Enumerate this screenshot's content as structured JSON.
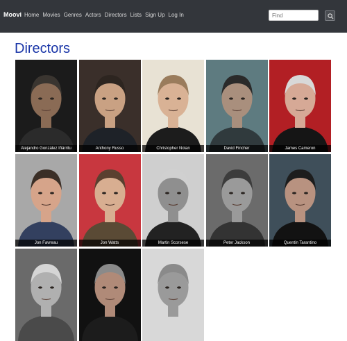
{
  "nav": {
    "brand": "Moovi",
    "links": [
      "Home",
      "Movies",
      "Genres",
      "Actors",
      "Directors",
      "Lists",
      "Sign Up",
      "Log In"
    ],
    "search_placeholder": "Find",
    "search_icon": "search-icon"
  },
  "page": {
    "title": "Directors"
  },
  "directors": [
    {
      "name": "Alejandro González Iñárritu",
      "bg": "#1b1b1b",
      "skin": "#8a6b55",
      "hair": "#3a3530",
      "shirt": "#2b2b2b"
    },
    {
      "name": "Anthony Russo",
      "bg": "#3a2f2a",
      "skin": "#c9a183",
      "hair": "#2d2520",
      "shirt": "#1e2228"
    },
    {
      "name": "Christopher Nolan",
      "bg": "#e8e2d4",
      "skin": "#d9b295",
      "hair": "#9a7c5c",
      "shirt": "#1c1c1c"
    },
    {
      "name": "David Fincher",
      "bg": "#5e7b80",
      "skin": "#a98f7d",
      "hair": "#2a2a2a",
      "shirt": "#303a3d"
    },
    {
      "name": "James Cameron",
      "bg": "#b21f24",
      "skin": "#d6a996",
      "hair": "#d8d8d8",
      "shirt": "#151515"
    },
    {
      "name": "Jon Favreau",
      "bg": "#a8a8a8",
      "skin": "#d6a48a",
      "hair": "#3b2f27",
      "shirt": "#33405f"
    },
    {
      "name": "Jon Watts",
      "bg": "#c8373f",
      "skin": "#d8ae91",
      "hair": "#5a4030",
      "shirt": "#5a4a35"
    },
    {
      "name": "Martin Scorsese",
      "bg": "#cfcfcf",
      "skin": "#8f8f8f",
      "hair": "#d0d0d0",
      "shirt": "#222222"
    },
    {
      "name": "Peter Jackson",
      "bg": "#6b6b6b",
      "skin": "#9a9a9a",
      "hair": "#3c3c3c",
      "shirt": "#333333"
    },
    {
      "name": "Quentin Tarantino",
      "bg": "#3f4f5a",
      "skin": "#b89280",
      "hair": "#1d1d1d",
      "shirt": "#121212"
    },
    {
      "name": "",
      "bg": "#6a6a6a",
      "skin": "#b0b0b0",
      "hair": "#d5d5d5",
      "shirt": "#4a4a4a"
    },
    {
      "name": "",
      "bg": "#111111",
      "skin": "#b08a78",
      "hair": "#8a8a8a",
      "shirt": "#1c1c1c"
    },
    {
      "name": "",
      "bg": "#d8d8d8",
      "skin": "#9a9a9a",
      "hair": "#8a8a8a",
      "shirt": "#d8d8d8"
    }
  ]
}
